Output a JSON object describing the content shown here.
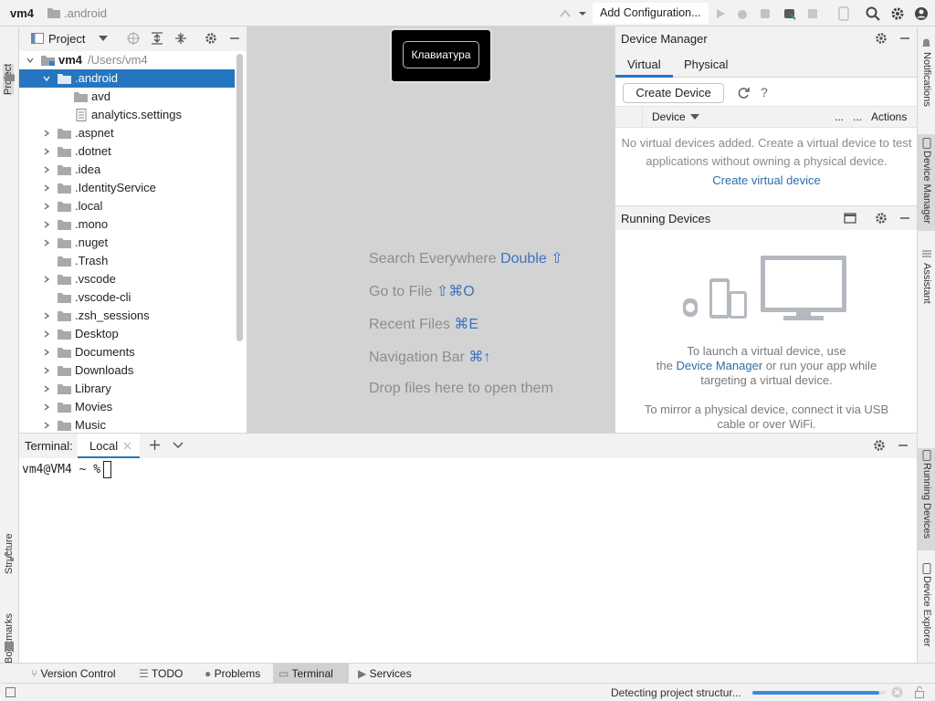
{
  "topbar": {
    "project": "vm4",
    "separator": "〉",
    "folder": ".android",
    "add_config": "Add Configuration..."
  },
  "left_strip": {
    "project": "Project",
    "structure": "Structure",
    "bookmarks": "Bookmarks"
  },
  "project_panel": {
    "title": "Project",
    "root_name": "vm4",
    "root_path": "/Users/vm4",
    "items": [
      {
        "label": ".android",
        "expanded": true,
        "selected": true
      },
      {
        "label": "avd",
        "child": true
      },
      {
        "label": "analytics.settings",
        "child": true,
        "file": true
      },
      {
        "label": ".aspnet"
      },
      {
        "label": ".dotnet"
      },
      {
        "label": ".idea"
      },
      {
        "label": ".IdentityService"
      },
      {
        "label": ".local"
      },
      {
        "label": ".mono"
      },
      {
        "label": ".nuget"
      },
      {
        "label": ".Trash",
        "leaf": true
      },
      {
        "label": ".vscode"
      },
      {
        "label": ".vscode-cli",
        "leaf": true
      },
      {
        "label": ".zsh_sessions"
      },
      {
        "label": "Desktop"
      },
      {
        "label": "Documents"
      },
      {
        "label": "Downloads"
      },
      {
        "label": "Library"
      },
      {
        "label": "Movies"
      },
      {
        "label": "Music"
      }
    ]
  },
  "editor": {
    "keyboard_tip": "Клавиатура",
    "hints": [
      {
        "text": "Search Everywhere",
        "key": "Double ⇧"
      },
      {
        "text": "Go to File",
        "key": "⇧⌘O"
      },
      {
        "text": "Recent Files",
        "key": "⌘E"
      },
      {
        "text": "Navigation Bar",
        "key": "⌘↑"
      },
      {
        "text": "Drop files here to open them",
        "key": ""
      }
    ]
  },
  "device_manager": {
    "title": "Device Manager",
    "tab_virtual": "Virtual",
    "tab_physical": "Physical",
    "create_device": "Create Device",
    "col_device": "Device",
    "col_dots1": "...",
    "col_dots2": "...",
    "col_actions": "Actions",
    "empty_line1": "No virtual devices added. Create a virtual device to test",
    "empty_line2": "applications without owning a physical device.",
    "create_virtual": "Create virtual device"
  },
  "running_devices": {
    "title": "Running Devices",
    "line1": "To launch a virtual device, use",
    "line2_prefix": "the",
    "line2_link": "Device Manager",
    "line2_suffix": "or run your app while",
    "line3": "targeting a virtual device.",
    "line4": "To mirror a physical device, connect it via USB",
    "line5": "cable or over WiFi."
  },
  "right_strip": {
    "notifications": "Notifications",
    "device_manager": "Device Manager",
    "assistant": "Assistant",
    "running_devices": "Running Devices",
    "device_explorer": "Device Explorer"
  },
  "terminal": {
    "label": "Terminal:",
    "tab_local": "Local",
    "prompt": "vm4@VM4 ~ %"
  },
  "bottom_tabs": {
    "version_control": "Version Control",
    "todo": "TODO",
    "problems": "Problems",
    "terminal": "Terminal",
    "services": "Services"
  },
  "status": {
    "text": "Detecting project structur...",
    "progress": 0.95
  },
  "colors": {
    "selection": "#2675bf",
    "link": "#2f6ca8",
    "progress": "#3b8be0"
  }
}
